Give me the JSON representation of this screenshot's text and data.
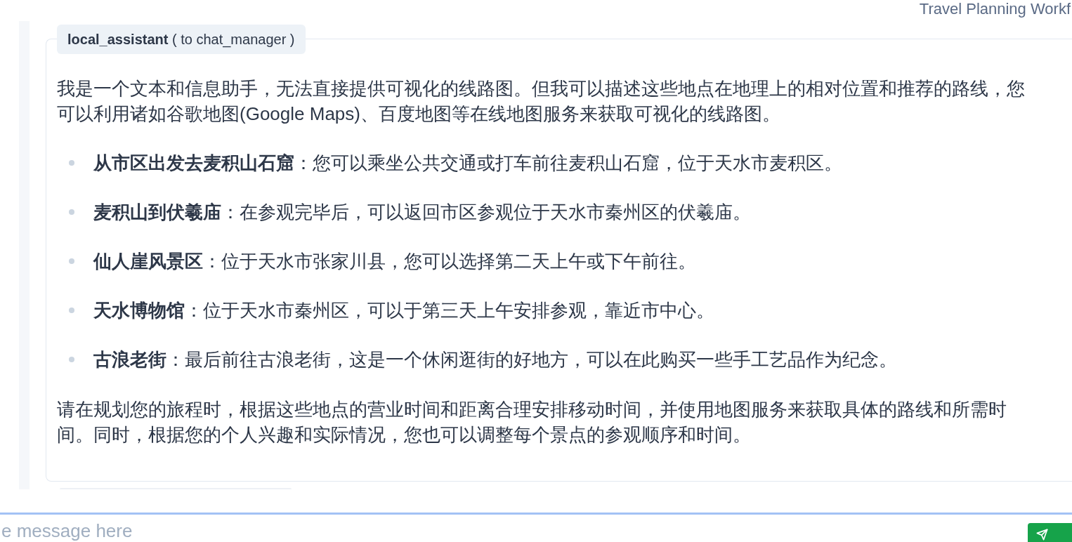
{
  "header": {
    "title": "Travel Planning Workf"
  },
  "message": {
    "badge": "**local_assistant** ( to chat_manager )",
    "intro": "我是一个文本和信息助手，无法直接提供可视化的线路图。但我可以描述这些地点在地理上的相对位置和推荐的路线，您可以利用诸如谷歌地图(Google Maps)、百度地图等在线地图服务来获取可视化的线路图。",
    "items": [
      "**从市区出发去麦积山石窟**：您可以乘坐公共交通或打车前往麦积山石窟，位于天水市麦积区。",
      "**麦积山到伏羲庙**：在参观完毕后，可以返回市区参观位于天水市秦州区的伏羲庙。",
      "**仙人崖风景区**：位于天水市张家川县，您可以选择第二天上午或下午前往。",
      "**天水博物馆**：位于天水市秦州区，可以于第三天上午安排参观，靠近市中心。",
      "**古浪老街**：最后前往古浪老街，这是一个休闲逛街的好地方，可以在此购买一些手工艺品作为纪念。"
    ],
    "closing": "请在规划您的旅程时，根据这些地点的营业时间和距离合理安排移动时间，并使用地图服务来获取具体的路线和所需时间。同时，根据您的个人兴趣和实际情况，您也可以调整每个景点的参观顺序和时间。"
  },
  "composer": {
    "placeholder": "e message here"
  }
}
